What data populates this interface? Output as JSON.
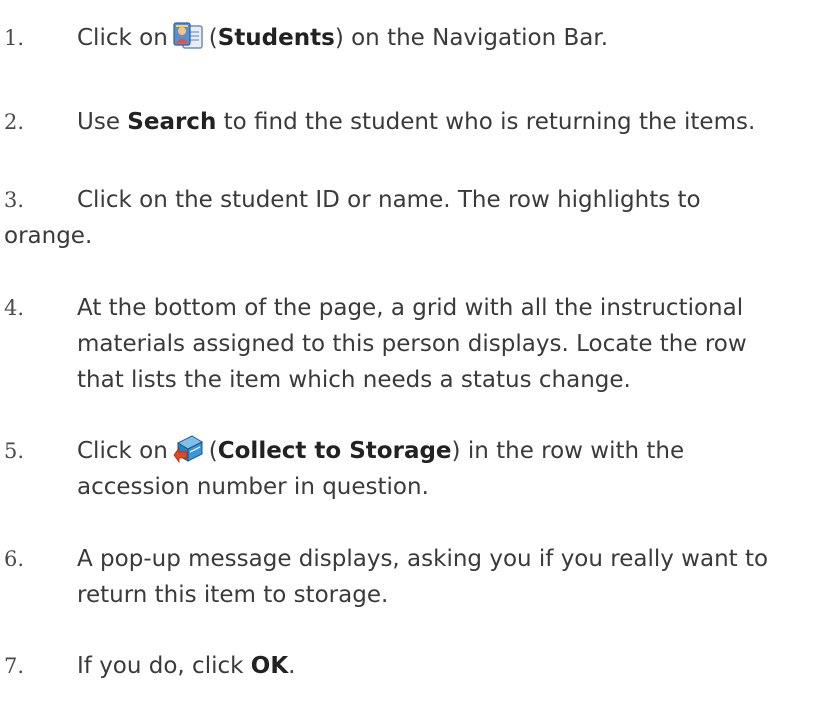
{
  "steps": [
    {
      "number": "1.",
      "prefix": "Click on",
      "icon": "students-icon",
      "open": "(",
      "bold": "Students",
      "close": ")",
      "suffix": " on the Navigation Bar."
    },
    {
      "number": "2.",
      "prefix": "Use ",
      "bold": "Search",
      "suffix": " to find the student who is returning the items."
    },
    {
      "number": "3.",
      "line1": "Click on the student ID or name. The row highlights to",
      "line2": "orange."
    },
    {
      "number": "4.",
      "text": "At the bottom of the page, a grid with all the instructional materials assigned to this person displays. Locate the row that lists the item which needs a status change."
    },
    {
      "number": "5.",
      "prefix": "Click on",
      "icon": "collect-to-storage-icon",
      "open": "(",
      "bold": "Collect to Storage",
      "close": ")",
      "suffix": " in the row with the accession number in question."
    },
    {
      "number": "6.",
      "text": "A pop-up message displays, asking you if you really want to return this item to storage."
    },
    {
      "number": "7.",
      "prefix": "If you do, click ",
      "bold": "OK",
      "suffix": "."
    }
  ],
  "colors": {
    "text": "#3a3a3a",
    "bold": "#222222",
    "students_icon_bg": "#5b8fd4",
    "collect_icon_book": "#2a7fc4",
    "collect_icon_arrow": "#e04a22"
  }
}
